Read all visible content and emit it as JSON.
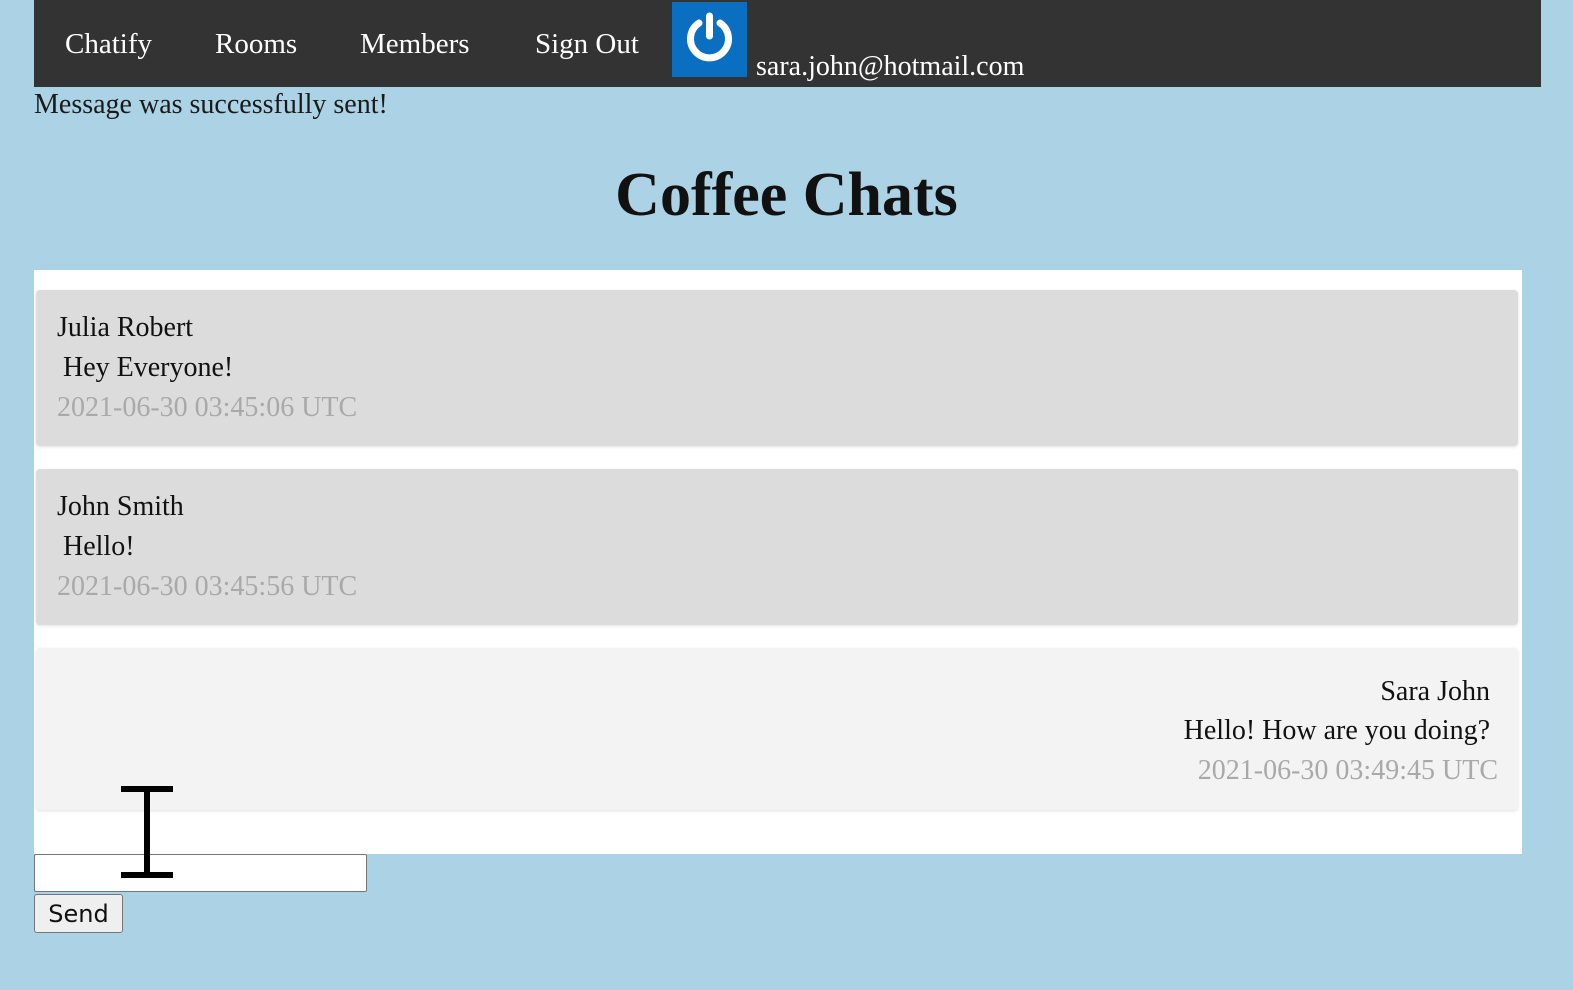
{
  "nav": {
    "brand": "Chatify",
    "rooms": "Rooms",
    "members": "Members",
    "sign_out": "Sign Out",
    "icon": "power-icon",
    "user_email": "sara.john@hotmail.com"
  },
  "flash_message": "Message was successfully sent!",
  "room": {
    "title": "Coffee Chats"
  },
  "messages": [
    {
      "author": "Julia Robert",
      "text": "Hey Everyone!",
      "timestamp": "2021-06-30 03:45:06 UTC",
      "mine": false
    },
    {
      "author": "John Smith",
      "text": "Hello!",
      "timestamp": "2021-06-30 03:45:56 UTC",
      "mine": false
    },
    {
      "author": "Sara John",
      "text": "Hello! How are you doing?",
      "timestamp": "2021-06-30 03:49:45 UTC",
      "mine": true
    }
  ],
  "composer": {
    "value": "",
    "send_label": "Send"
  },
  "colors": {
    "background": "#abd2e5",
    "navbar": "#333333",
    "power_button": "#0a6fc0",
    "other_message": "#dcdcdc",
    "own_message": "#f3f3f3",
    "timestamp": "#a9a9a9"
  }
}
